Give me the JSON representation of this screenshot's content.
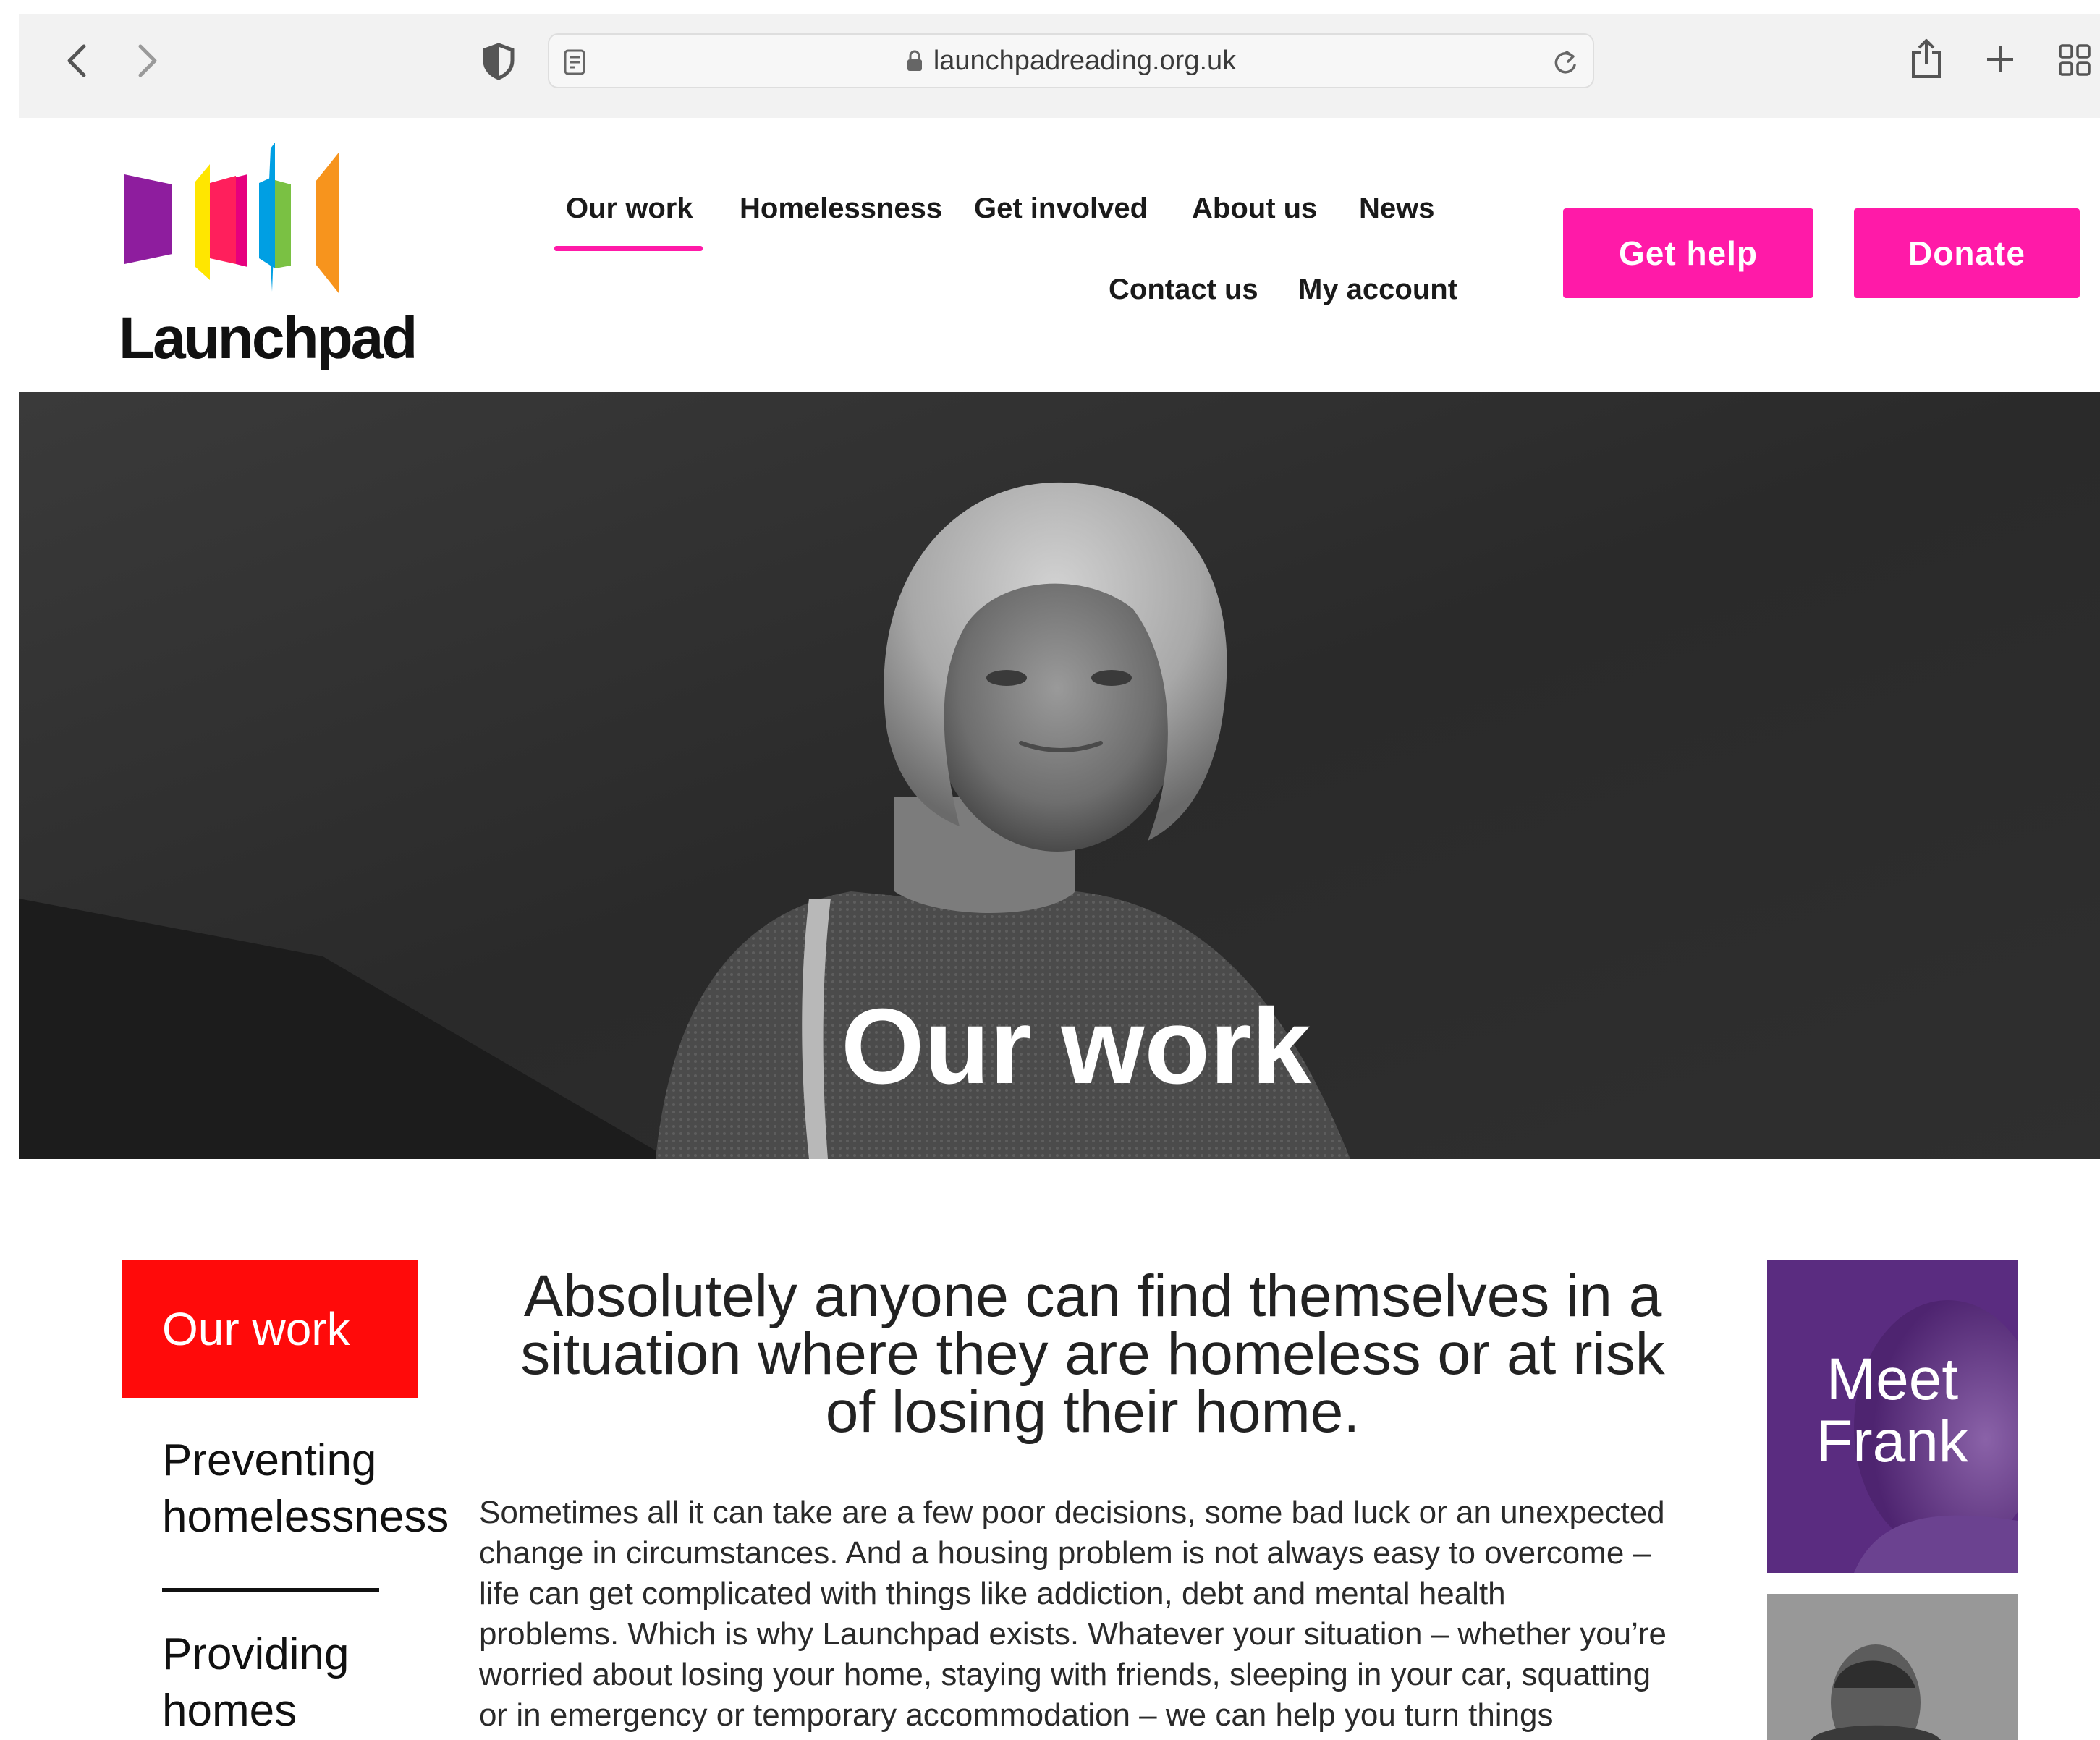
{
  "browser": {
    "url": "launchpadreading.org.uk",
    "icons": [
      "back-icon",
      "forward-icon",
      "privacy-shield-icon",
      "reader-icon",
      "lock-icon",
      "reload-icon",
      "share-icon",
      "new-tab-icon",
      "tab-overview-icon"
    ]
  },
  "header": {
    "logo_text": "Launchpad",
    "nav": {
      "our_work": "Our work",
      "homelessness": "Homelessness",
      "get_involved": "Get involved",
      "about_us": "About us",
      "news": "News",
      "contact_us": "Contact us",
      "my_account": "My account"
    },
    "get_help": "Get help",
    "donate": "Donate",
    "accent_color": "#ff1aa8"
  },
  "hero": {
    "title": "Our work"
  },
  "sidebar": {
    "active": "Our work",
    "item1_line1": "Preventing",
    "item1_line2": "homelessness",
    "item2_line1": "Providing",
    "item2_line2": "homes",
    "active_color": "#ff0a0a"
  },
  "main": {
    "headline_line1": "Absolutely anyone can find themselves in a",
    "headline_line2": "situation where they are homeless or at risk",
    "headline_line3": "of losing their home.",
    "body_lines": [
      "Sometimes all it can take are a few poor decisions, some bad luck or an unexpected",
      "change in circumstances. And a housing problem is not always easy to overcome –",
      "life can get complicated with things like addiction, debt and mental health",
      "problems. Which is why Launchpad exists. Whatever your situation – whether you’re",
      "worried about losing your home, staying with friends, sleeping in your car, squatting",
      "or in emergency or temporary accommodation – we can help you turn things"
    ]
  },
  "aside": {
    "meet_line1": "Meet",
    "meet_line2": "Frank"
  }
}
